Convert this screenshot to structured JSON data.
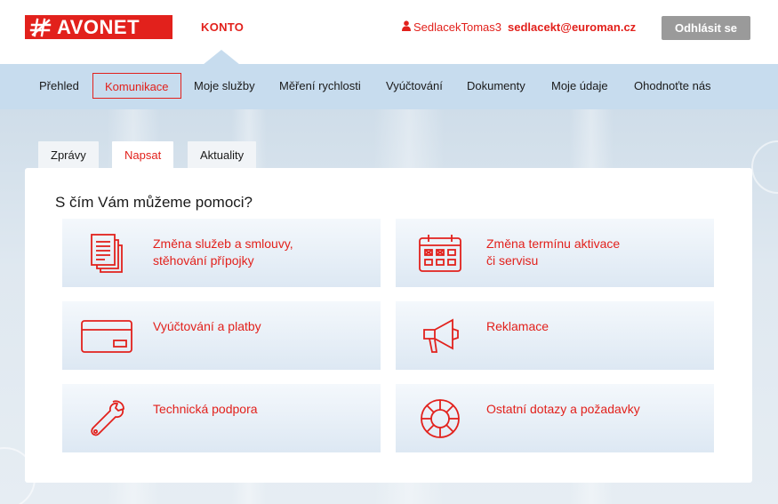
{
  "header": {
    "logo_text": "AVONET",
    "konto_label": "KONTO",
    "username": "SedlacekTomas3",
    "email": "sedlacekt@euroman.cz",
    "logout_label": "Odhlásit se",
    "brand_color": "#e2211c"
  },
  "nav": {
    "items": [
      {
        "label": "Přehled"
      },
      {
        "label": "Komunikace",
        "active": true
      },
      {
        "label": "Moje služby"
      },
      {
        "label": "Měření rychlosti"
      },
      {
        "label": "Vyúčtování"
      },
      {
        "label": "Dokumenty"
      },
      {
        "label": "Moje údaje"
      },
      {
        "label": "Ohodnoťte nás"
      }
    ]
  },
  "tabs": [
    {
      "label": "Zprávy"
    },
    {
      "label": "Napsat",
      "active": true
    },
    {
      "label": "Aktuality"
    }
  ],
  "panel": {
    "title": "S čím Vám můžeme pomoci?",
    "cards": [
      {
        "line1": "Změna služeb a smlouvy,",
        "line2": "stěhování přípojky",
        "icon": "documents-icon"
      },
      {
        "line1": "Změna termínu aktivace",
        "line2": "či servisu",
        "icon": "calendar-icon"
      },
      {
        "line1": "Vyúčtování a platby",
        "line2": "",
        "icon": "credit-card-icon"
      },
      {
        "line1": "Reklamace",
        "line2": "",
        "icon": "megaphone-icon"
      },
      {
        "line1": "Technická podpora",
        "line2": "",
        "icon": "wrench-icon"
      },
      {
        "line1": "Ostatní dotazy a požadavky",
        "line2": "",
        "icon": "lifebuoy-icon"
      }
    ]
  }
}
